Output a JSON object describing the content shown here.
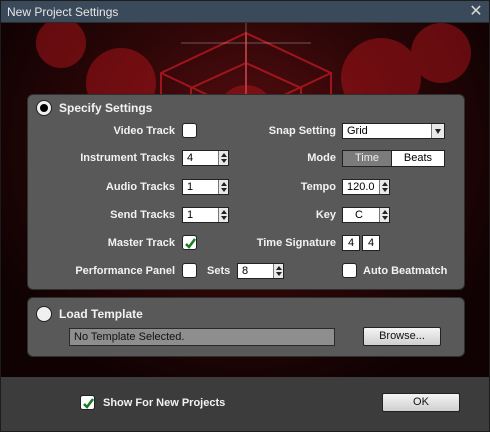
{
  "window": {
    "title": "New Project Settings"
  },
  "specify": {
    "title": "Specify Settings",
    "video_track": {
      "label": "Video Track",
      "checked": false
    },
    "instrument_tracks": {
      "label": "Instrument Tracks",
      "value": "4"
    },
    "audio_tracks": {
      "label": "Audio Tracks",
      "value": "1"
    },
    "send_tracks": {
      "label": "Send Tracks",
      "value": "1"
    },
    "master_track": {
      "label": "Master Track",
      "checked": true
    },
    "performance_panel": {
      "label": "Performance Panel",
      "checked": false
    },
    "sets": {
      "label": "Sets",
      "value": "8"
    },
    "snap_setting": {
      "label": "Snap Setting",
      "value": "Grid"
    },
    "mode": {
      "label": "Mode",
      "options": [
        "Time",
        "Beats"
      ],
      "selected": "Beats"
    },
    "tempo": {
      "label": "Tempo",
      "value": "120.0"
    },
    "key": {
      "label": "Key",
      "value": "C"
    },
    "time_signature": {
      "label": "Time Signature",
      "numerator": "4",
      "denominator": "4"
    },
    "auto_beatmatch": {
      "label": "Auto Beatmatch",
      "checked": false
    }
  },
  "template": {
    "title": "Load Template",
    "current": "No Template Selected.",
    "browse_label": "Browse..."
  },
  "footer": {
    "show_for_new": {
      "label": "Show For New Projects",
      "checked": true
    },
    "ok_label": "OK"
  },
  "colors": {
    "title_bar": "#3b4a5a",
    "panel": "#595959",
    "banner_red": "#5a0d10",
    "check_green": "#1a7a22"
  }
}
